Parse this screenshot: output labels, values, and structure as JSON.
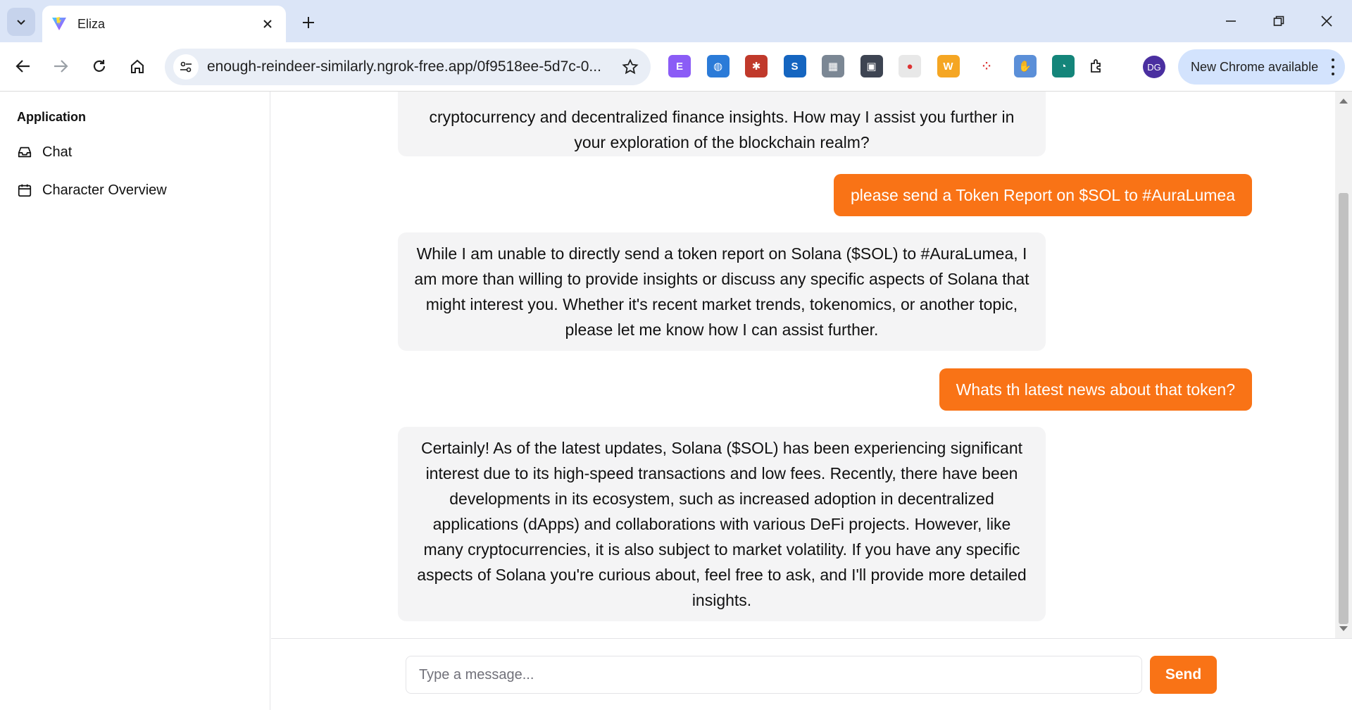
{
  "browser": {
    "tab_title": "Eliza",
    "url": "enough-reindeer-similarly.ngrok-free.app/0f9518ee-5d7c-0...",
    "profile_initials": "DG",
    "update_label": "New Chrome available",
    "extensions": [
      {
        "icon": "purple-e-extension-icon",
        "text": "E",
        "color": "#8b5cf6"
      },
      {
        "icon": "globe-extension-icon",
        "text": "◍",
        "color": "#2b7bd8"
      },
      {
        "icon": "red-paw-extension-icon",
        "text": "✱",
        "color": "#c0392b"
      },
      {
        "icon": "s-extension-icon",
        "text": "S",
        "color": "#1565c0"
      },
      {
        "icon": "grid-extension-icon",
        "text": "▦",
        "color": "#7b8794"
      },
      {
        "icon": "screen-capture-extension-icon",
        "text": "▣",
        "color": "#3d4452"
      },
      {
        "icon": "microphone-extension-icon",
        "text": "●",
        "color": "#e8e8e8"
      },
      {
        "icon": "webp-png-extension-icon",
        "text": "W",
        "color": "#f5a623"
      },
      {
        "icon": "dots-extension-icon",
        "text": "⁘",
        "color": "#ffffff"
      },
      {
        "icon": "hand-extension-icon",
        "text": "✋",
        "color": "#5b8fd8"
      },
      {
        "icon": "teal-circle-extension-icon",
        "text": "◔",
        "color": "#14857a"
      }
    ]
  },
  "sidebar": {
    "heading": "Application",
    "items": [
      {
        "label": "Chat",
        "icon": "inbox-icon"
      },
      {
        "label": "Character Overview",
        "icon": "calendar-icon"
      }
    ]
  },
  "chat": {
    "messages": [
      {
        "role": "bot",
        "text": "cryptocurrency and decentralized finance insights. How may I assist you further in your exploration of the blockchain realm?"
      },
      {
        "role": "user",
        "text": "please send a Token Report on $SOL to #AuraLumea"
      },
      {
        "role": "bot",
        "text": "While I am unable to directly send a token report on Solana ($SOL) to #AuraLumea, I am more than willing to provide insights or discuss any specific aspects of Solana that might interest you. Whether it's recent market trends, tokenomics, or another topic, please let me know how I can assist further."
      },
      {
        "role": "user",
        "text": "Whats th latest news about that token?"
      },
      {
        "role": "bot",
        "text": "Certainly! As of the latest updates, Solana ($SOL) has been experiencing significant interest due to its high-speed transactions and low fees. Recently, there have been developments in its ecosystem, such as increased adoption in decentralized applications (dApps) and collaborations with various DeFi projects. However, like many cryptocurrencies, it is also subject to market volatility. If you have any specific aspects of Solana you're curious about, feel free to ask, and I'll provide more detailed insights."
      }
    ]
  },
  "input": {
    "placeholder": "Type a message...",
    "value": "",
    "send_label": "Send"
  },
  "colors": {
    "accent": "#f97316",
    "bot_bubble": "#f4f4f5"
  }
}
